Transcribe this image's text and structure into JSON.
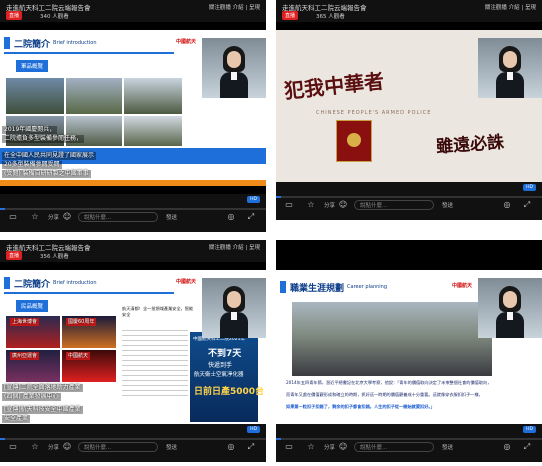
{
  "panels": [
    {
      "title": "走進航天科工二院云端報告會",
      "live": "直播",
      "viewers": "340 人觀看",
      "controls": "關注觀播 介紹 | 呈現",
      "slide": {
        "heading": "二院簡介",
        "heading_en": "Brief introduction",
        "tag": "軍品概覽",
        "logo": "中國航天",
        "captions": [
          "2019年國慶閱兵，",
          "二院擔負多型裝備參閱任務，",
          "在全中國人民共同見證了國家展示",
          "20多型裝備參閱受閱",
          "(受閱) 裝備自研研製之中國軍事"
        ]
      },
      "bottom": {
        "share": "分享",
        "input_placeholder": "說點什麼...",
        "send": "發送",
        "badge": "HD"
      }
    },
    {
      "title": "走進航天科工二院云端報告會",
      "live": "直播",
      "viewers": "365 人觀看",
      "controls": "關注觀播 介紹 | 呈現",
      "slide": {
        "calligraphy_left": "犯我中華者",
        "calligraphy_right": "雖遠必誅",
        "subtitle": "CHINESE PEOPLE'S ARMED POLICE"
      },
      "bottom": {
        "share": "分享",
        "input_placeholder": "說點什麼...",
        "send": "發送",
        "badge": "HD"
      }
    },
    {
      "title": "走進航天科工二院云端報告會",
      "live": "直播",
      "viewers": "356 人觀看",
      "controls": "關注觀播 介紹 | 呈現",
      "slide": {
        "heading": "二院簡介",
        "heading_en": "Brief introduction",
        "tag": "民品概覽",
        "logo": "中國航天",
        "tiles": [
          "上海世博會",
          "國慶60周年",
          "廣州亞運會",
          "中國航天"
        ],
        "caption1": "[宣傳]二院全面落地助力產業",
        "caption2": "(四個) 產業發展中心",
        "caption3": "[宣傳]航天科技安全中國產業",
        "caption4": "安全產業",
        "intro_text": "航天清都！全一批領域產業安全，智能安全",
        "promo_line1": "中國航天科工二院2021年",
        "promo_line2": "不到7天",
        "promo_line3": "快遞到手",
        "promo_line4": "航天衛士空氣凈化器",
        "promo_line5": "日前日產5000台"
      },
      "bottom": {
        "share": "分享",
        "input_placeholder": "說點什麼...",
        "send": "發送",
        "badge": "HD"
      }
    },
    {
      "title": "",
      "slide": {
        "heading": "職業生涯規劃",
        "heading_en": "Career planning",
        "logo": "中國航天",
        "quote_line1": "2014年五四青年節，習近平總書記在北京大學考察，他說：「青年的價值取向決定了未來整個社會的價值取向，",
        "quote_line2": "而青年又處在價值觀形成和確立的時期，抓好這一時期的價值觀養成十分重要。這就像穿衣服扣扣子一樣，",
        "quote_line3": "如果第一粒扣子扣錯了，剩余的扣子都會扣錯。人生的扣子從一開始就要扣好。」"
      },
      "bottom": {
        "share": "分享",
        "input_placeholder": "說點什麼...",
        "send": "發送",
        "badge": "HD"
      }
    }
  ]
}
